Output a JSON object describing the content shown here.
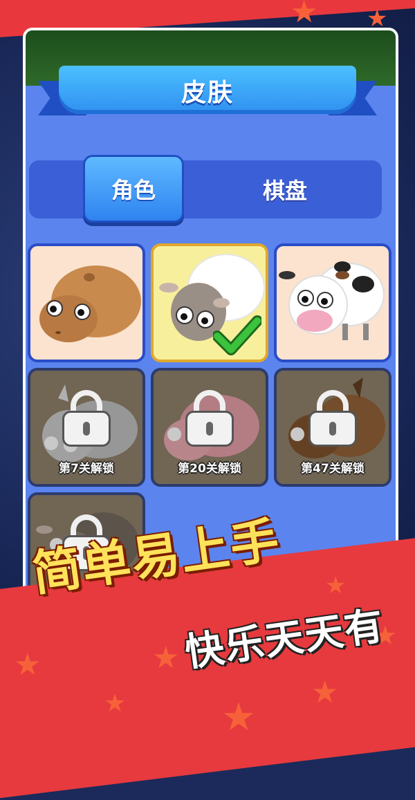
{
  "title": "皮肤",
  "tabs": [
    {
      "label": "角色",
      "active": true
    },
    {
      "label": "棋盘",
      "active": false
    }
  ],
  "skins": [
    {
      "name": "capybara",
      "state": "owned",
      "color": "#c98a4e"
    },
    {
      "name": "sheep",
      "state": "selected",
      "color": "#ffffff"
    },
    {
      "name": "cow",
      "state": "owned",
      "color": "#ffffff"
    },
    {
      "name": "goat",
      "state": "locked",
      "unlock": "第7关解锁",
      "color": "#d8d8d8"
    },
    {
      "name": "pig",
      "state": "locked",
      "unlock": "第20关解锁",
      "color": "#f2a8b0"
    },
    {
      "name": "horse",
      "state": "locked",
      "unlock": "第47关解锁",
      "color": "#8c5a2e"
    },
    {
      "name": "brown-sheep",
      "state": "locked",
      "unlock": "",
      "color": "#9c8670"
    }
  ],
  "slogan_main": "简单易上手",
  "slogan_sub": "快乐天天有",
  "colors": {
    "accent": "#4a73e8",
    "banner": "#e63a3e",
    "check": "#3cc23c"
  }
}
